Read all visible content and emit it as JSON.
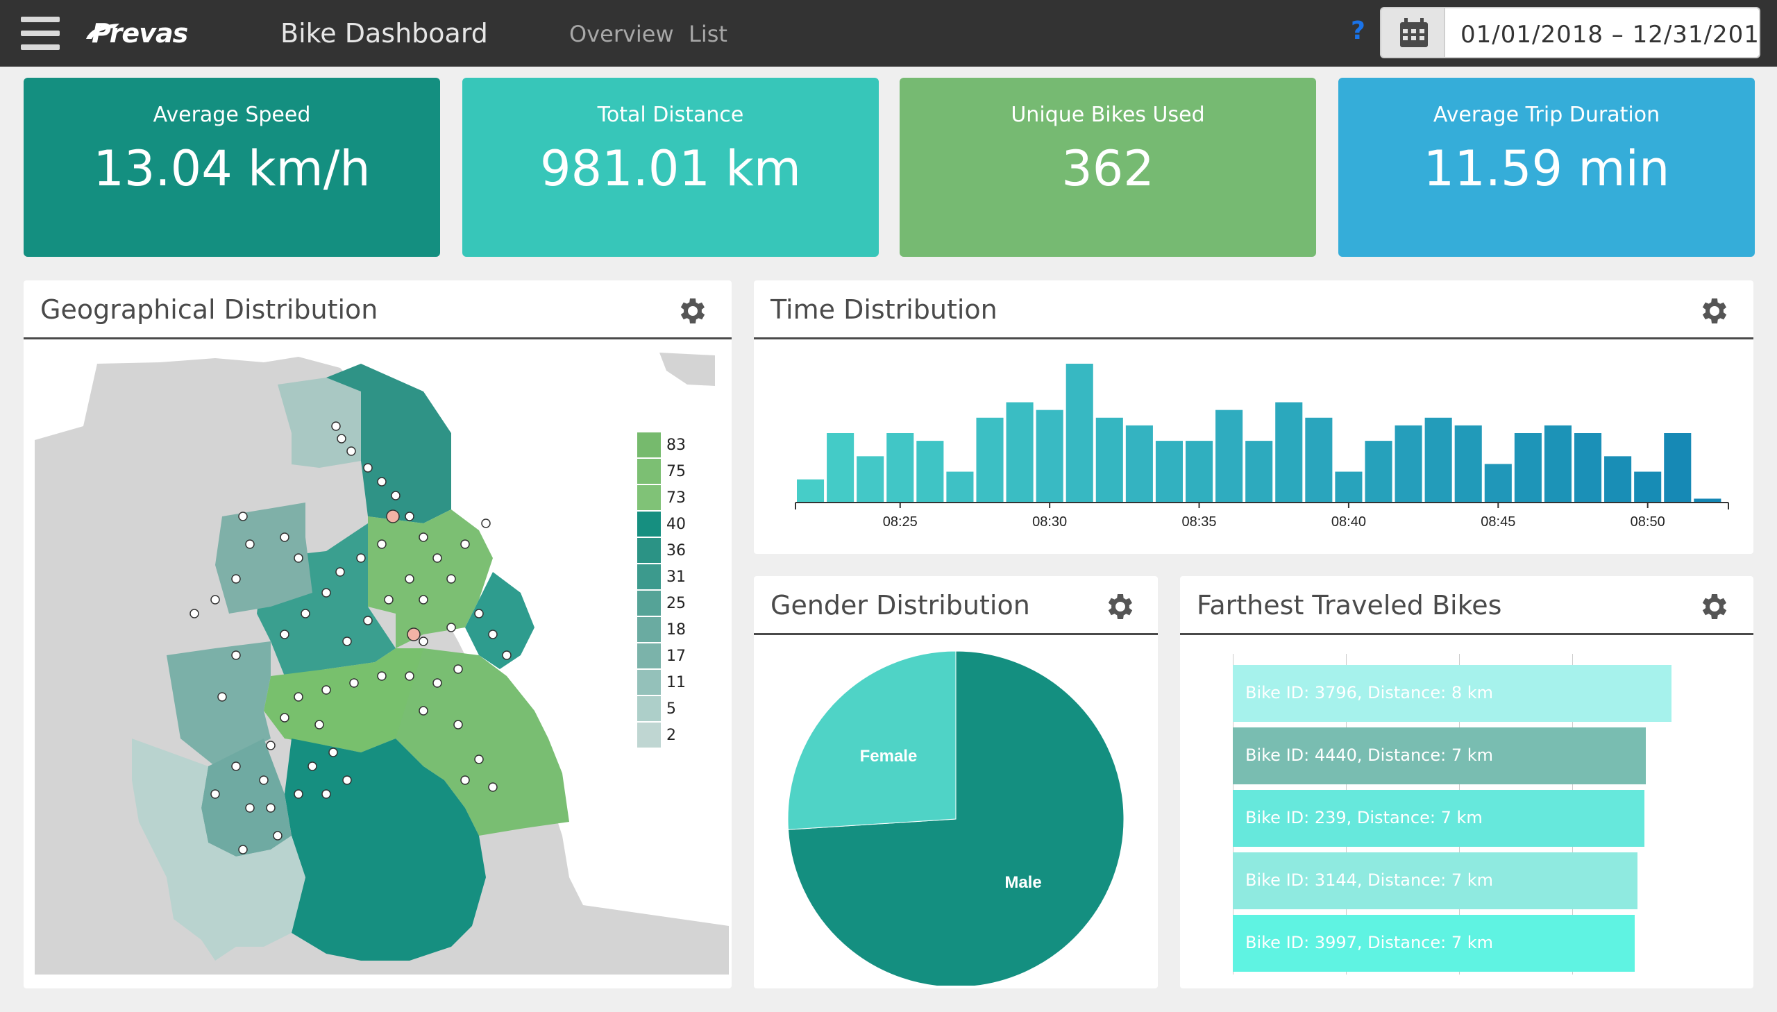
{
  "header": {
    "app_title": "Bike Dashboard",
    "logo_text": "Prevas",
    "nav": [
      "Overview",
      "List"
    ],
    "help_label": "?",
    "date_range": "01/01/2018 – 12/31/201"
  },
  "kpis": [
    {
      "label": "Average Speed",
      "value": "13.04 km/h",
      "color": "#148f80"
    },
    {
      "label": "Total Distance",
      "value": "981.01 km",
      "color": "#37c6b9"
    },
    {
      "label": "Unique Bikes Used",
      "value": "362",
      "color": "#76ba72"
    },
    {
      "label": "Average Trip Duration",
      "value": "11.59 min",
      "color": "#35add9"
    }
  ],
  "panels": {
    "geo_title": "Geographical Distribution",
    "time_title": "Time Distribution",
    "gender_title": "Gender Distribution",
    "far_title": "Farthest Traveled Bikes"
  },
  "map_legend": [
    "83",
    "75",
    "73",
    "40",
    "36",
    "31",
    "25",
    "18",
    "17",
    "11",
    "5",
    "2"
  ],
  "chart_data": [
    {
      "type": "bar",
      "x_tick_labels": [
        "08:25",
        "08:30",
        "08:35",
        "08:40",
        "08:45",
        "08:50"
      ],
      "values": [
        3,
        9,
        6,
        9,
        8,
        4,
        11,
        13,
        12,
        18,
        11,
        10,
        8,
        8,
        12,
        8,
        13,
        11,
        4,
        8,
        10,
        11,
        10,
        5,
        9,
        10,
        9,
        6,
        4,
        9,
        0.5
      ],
      "ylim": [
        0,
        18
      ],
      "grid": false
    },
    {
      "type": "pie",
      "labels": [
        "Male",
        "Female"
      ],
      "values": [
        74,
        26
      ],
      "colors": [
        "#148f80",
        "#4fd3c6"
      ]
    },
    {
      "type": "bar",
      "orientation": "horizontal",
      "categories": [
        "Bike ID: 3796, Distance: 8 km",
        "Bike ID: 4440, Distance: 7 km",
        "Bike ID: 239, Distance: 7 km",
        "Bike ID: 3144, Distance: 7 km",
        "Bike ID: 3997, Distance: 7 km"
      ],
      "values": [
        7.75,
        7.3,
        7.27,
        7.15,
        7.1
      ],
      "xlim": [
        0,
        8
      ],
      "colors": [
        "#a6f2ec",
        "#79bdb1",
        "#66e8dc",
        "#8feae0",
        "#5ff3e2"
      ],
      "grid": true
    }
  ]
}
